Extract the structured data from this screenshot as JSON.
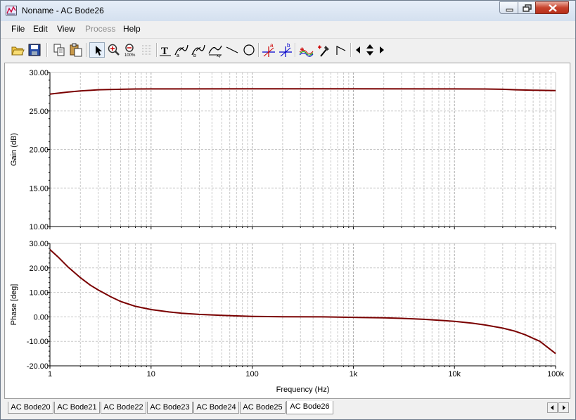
{
  "window": {
    "title": "Noname - AC Bode26"
  },
  "menu": {
    "items": [
      {
        "label": "File",
        "enabled": true
      },
      {
        "label": "Edit",
        "enabled": true
      },
      {
        "label": "View",
        "enabled": true
      },
      {
        "label": "Process",
        "enabled": false
      },
      {
        "label": "Help",
        "enabled": true
      }
    ]
  },
  "toolbar": {
    "icons": [
      "open-folder-icon",
      "save-icon",
      "copy-icon",
      "paste-icon",
      "pointer-icon",
      "zoom-in-icon",
      "zoom-100-icon",
      "grid-icon",
      "text-icon",
      "cursor-a-label-icon",
      "cursor-b-label-icon",
      "axis-label-icon",
      "line-icon",
      "ellipse-icon",
      "cursor-a-icon",
      "cursor-b-icon",
      "add-curve-icon",
      "marker-icon",
      "polyline-icon",
      "move-left-icon",
      "move-updown-icon",
      "move-right-icon"
    ]
  },
  "chart_data": [
    {
      "type": "line",
      "ylabel": "Gain (dB)",
      "xlabel": "",
      "x_scale": "log",
      "xlim": [
        1,
        100000
      ],
      "ylim": [
        10,
        30
      ],
      "yticks": [
        "10.00",
        "15.00",
        "20.00",
        "25.00",
        "30.00"
      ],
      "grid": true,
      "color": "#7a0000",
      "series": [
        {
          "x": [
            1,
            1.5,
            2,
            3,
            5,
            7,
            10,
            100,
            1000,
            10000,
            20000,
            30000,
            40000,
            60000,
            100000
          ],
          "y": [
            27.2,
            27.45,
            27.6,
            27.75,
            27.82,
            27.85,
            27.86,
            27.87,
            27.87,
            27.86,
            27.85,
            27.82,
            27.75,
            27.7,
            27.65
          ]
        }
      ]
    },
    {
      "type": "line",
      "ylabel": "Phase [deg]",
      "xlabel": "Frequency (Hz)",
      "x_scale": "log",
      "xlim": [
        1,
        100000
      ],
      "ylim": [
        -20,
        30
      ],
      "yticks": [
        "-20.00",
        "-10.00",
        "0.00",
        "10.00",
        "20.00",
        "30.00"
      ],
      "xticks": [
        "1",
        "10",
        "100",
        "1k",
        "10k",
        "100k"
      ],
      "grid": true,
      "color": "#7a0000",
      "series": [
        {
          "x": [
            1,
            1.2,
            1.5,
            2,
            2.5,
            3,
            4,
            5,
            7,
            10,
            15,
            20,
            30,
            50,
            70,
            100,
            200,
            500,
            1000,
            2000,
            3000,
            5000,
            10000,
            15000,
            20000,
            30000,
            40000,
            50000,
            70000,
            100000
          ],
          "y": [
            27.5,
            24.5,
            20.5,
            16,
            13,
            11,
            8.2,
            6.3,
            4.3,
            3.0,
            2.0,
            1.5,
            1.0,
            0.6,
            0.4,
            0.2,
            0.05,
            0,
            -0.2,
            -0.4,
            -0.6,
            -1.0,
            -1.8,
            -2.6,
            -3.3,
            -4.6,
            -5.9,
            -7.3,
            -10,
            -15
          ]
        }
      ]
    }
  ],
  "tabs": {
    "items": [
      "AC Bode20",
      "AC Bode21",
      "AC Bode22",
      "AC Bode23",
      "AC Bode24",
      "AC Bode25",
      "AC Bode26"
    ],
    "active": "AC Bode26"
  }
}
